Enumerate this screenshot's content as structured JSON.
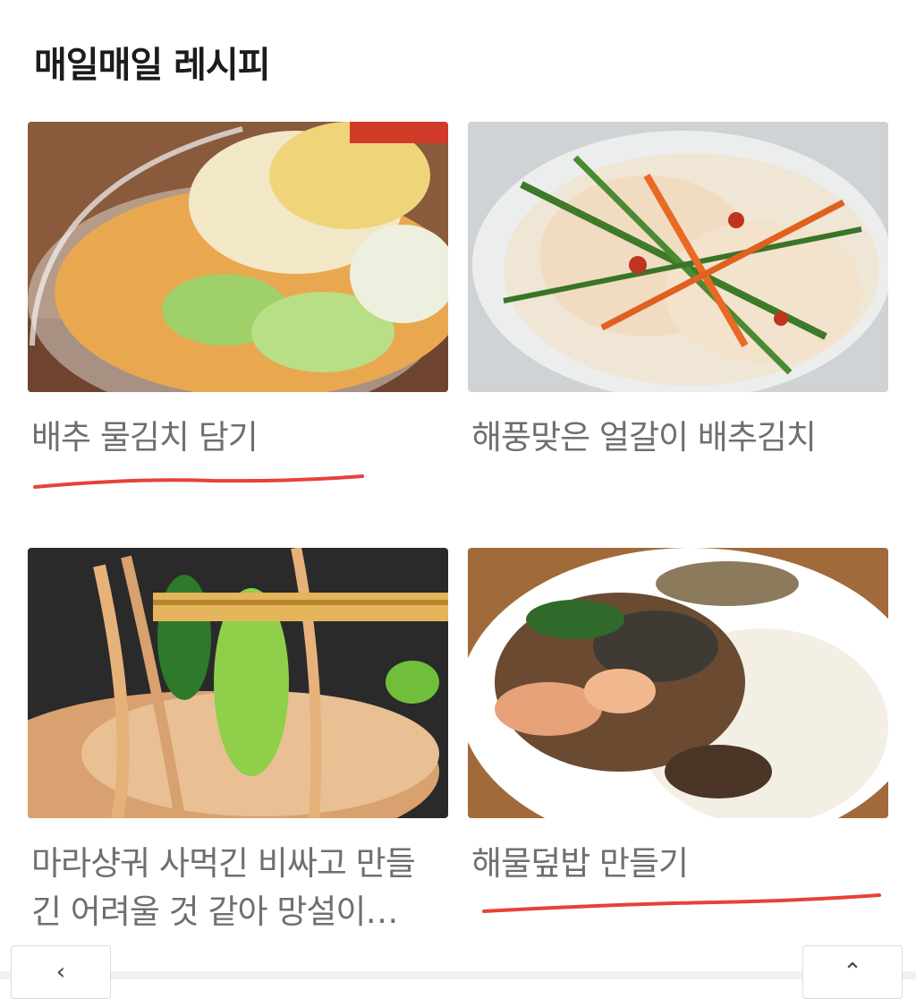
{
  "section": {
    "title": "매일매일 레시피"
  },
  "recipes": [
    {
      "title": "배추 물김치 담기",
      "image_icon": "photo-icon",
      "annotated": true
    },
    {
      "title": "해풍맞은 얼갈이 배추김치",
      "image_icon": "photo-icon",
      "annotated": false
    },
    {
      "title": "마라샹궈 사먹긴 비싸고 만들긴 어려울 것 같아 망설이셨다면",
      "image_icon": "photo-icon",
      "annotated": false
    },
    {
      "title": "해물덮밥 만들기",
      "image_icon": "photo-icon",
      "annotated": true
    }
  ],
  "annotation": {
    "color": "#e8413a",
    "style": "hand-drawn underline"
  },
  "nav": {
    "prev_icon": "chevron-left-icon",
    "top_icon": "arrow-up-icon"
  }
}
